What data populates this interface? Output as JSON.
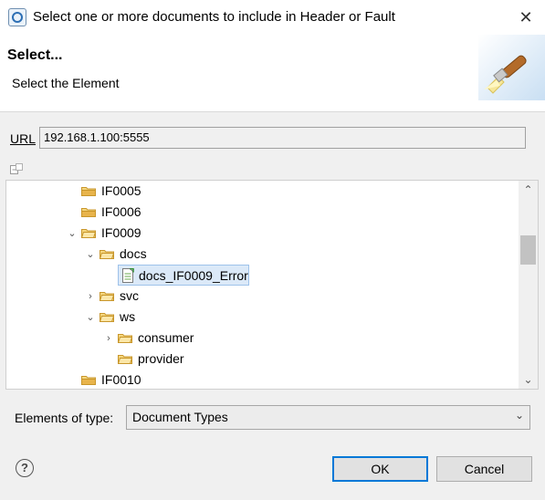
{
  "window": {
    "title": "Select one or more documents to include in Header or Fault"
  },
  "header": {
    "title": "Select...",
    "subtitle": "Select the Element"
  },
  "url": {
    "label": "URL",
    "value": "192.168.1.100:5555"
  },
  "tree": {
    "items": [
      {
        "label": "IF0005",
        "icon": "folder-icon",
        "twisty": ""
      },
      {
        "label": "IF0006",
        "icon": "folder-icon",
        "twisty": ""
      },
      {
        "label": "IF0009",
        "icon": "folder-icon",
        "twisty": "expanded"
      },
      {
        "label": "docs",
        "icon": "folder-icon",
        "twisty": "expanded"
      },
      {
        "label": "docs_IF0009_Error",
        "icon": "document-type-icon",
        "twisty": "",
        "selected": true
      },
      {
        "label": "svc",
        "icon": "folder-icon",
        "twisty": "collapsed"
      },
      {
        "label": "ws",
        "icon": "folder-icon",
        "twisty": "expanded"
      },
      {
        "label": "consumer",
        "icon": "folder-icon",
        "twisty": "collapsed"
      },
      {
        "label": "provider",
        "icon": "folder-icon",
        "twisty": ""
      },
      {
        "label": "IF0010",
        "icon": "folder-icon",
        "twisty": ""
      }
    ]
  },
  "element_type": {
    "label": "Elements of type:",
    "selected": "Document Types"
  },
  "buttons": {
    "ok": "OK",
    "cancel": "Cancel",
    "help": "?"
  },
  "icons": {
    "close": "close-icon",
    "app": "app-icon",
    "collapse_all": "collapse-all-icon",
    "banner": "wizard-banner-icon"
  },
  "colors": {
    "selection": "#dbe9f8",
    "ok_border": "#0078d7",
    "folder": "#e8b44c"
  }
}
